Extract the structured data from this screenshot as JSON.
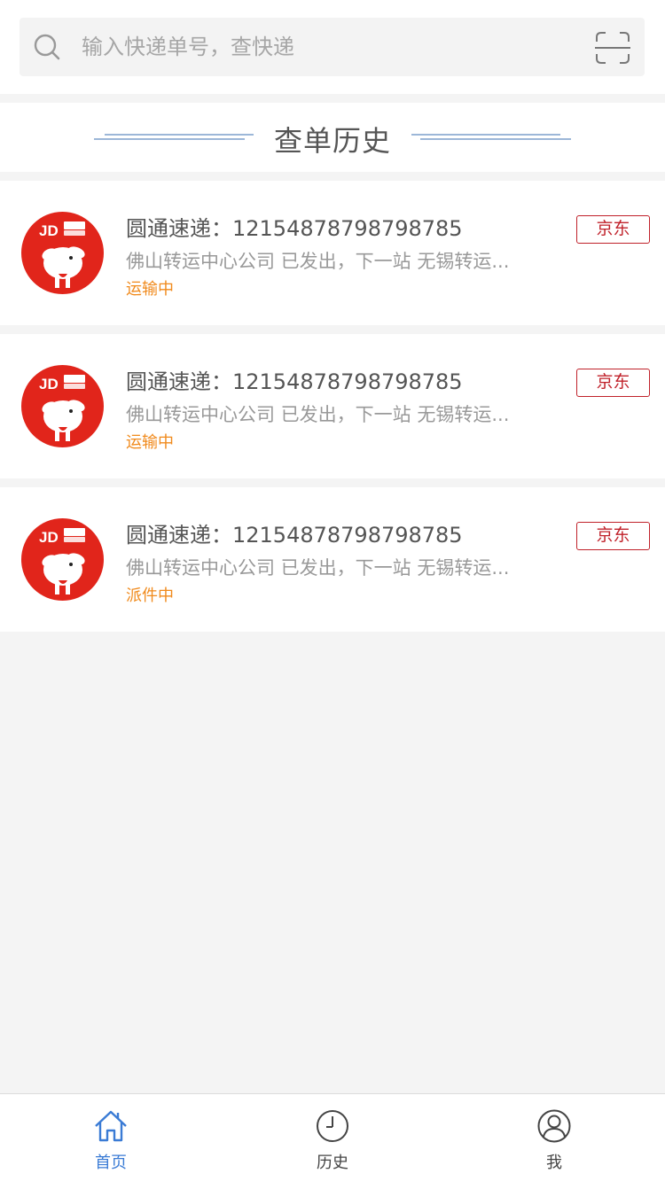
{
  "search": {
    "placeholder": "输入快递单号，查快递"
  },
  "section": {
    "title": "查单历史"
  },
  "colors": {
    "accent": "#3a7bd5",
    "tag_red": "#c0212a",
    "status_orange": "#f08a1c"
  },
  "cards": [
    {
      "title": "圆通速递：12154878798798785",
      "desc": "佛山转运中心公司 已发出，下一站 无锡转运...",
      "status": "运输中",
      "tag": "京东",
      "logo": "jd-logo"
    },
    {
      "title": "圆通速递：12154878798798785",
      "desc": "佛山转运中心公司 已发出，下一站 无锡转运...",
      "status": "运输中",
      "tag": "京东",
      "logo": "jd-logo"
    },
    {
      "title": "圆通速递：12154878798798785",
      "desc": "佛山转运中心公司 已发出，下一站 无锡转运...",
      "status": "派件中",
      "tag": "京东",
      "logo": "jd-logo"
    }
  ],
  "tabs": [
    {
      "label": "首页",
      "icon": "home-icon",
      "active": true
    },
    {
      "label": "历史",
      "icon": "clock-icon",
      "active": false
    },
    {
      "label": "我",
      "icon": "user-icon",
      "active": false
    }
  ]
}
